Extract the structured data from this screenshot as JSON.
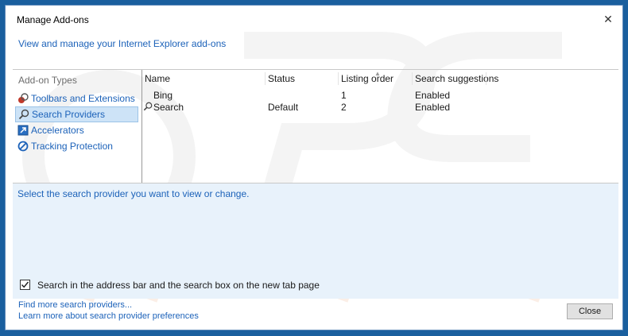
{
  "window": {
    "title": "Manage Add-ons",
    "header_link": "View and manage your Internet Explorer add-ons"
  },
  "sidebar": {
    "heading": "Add-on Types",
    "items": [
      {
        "label": "Toolbars and Extensions",
        "icon": "toolbars-extensions-icon"
      },
      {
        "label": "Search Providers",
        "icon": "search-providers-icon",
        "selected": true
      },
      {
        "label": "Accelerators",
        "icon": "accelerators-icon"
      },
      {
        "label": "Tracking Protection",
        "icon": "tracking-protection-icon"
      }
    ]
  },
  "list": {
    "columns": [
      "Name",
      "Status",
      "Listing order",
      "Search suggestions"
    ],
    "rows": [
      {
        "name": "Bing",
        "status": "",
        "order": "1",
        "suggestions": "Enabled"
      },
      {
        "name": "Search",
        "status": "Default",
        "order": "2",
        "suggestions": "Enabled"
      }
    ]
  },
  "detail": {
    "prompt": "Select the search provider you want to view or change.",
    "checkbox_label": "Search in the address bar and the search box on the new tab page",
    "checkbox_checked": true
  },
  "footer": {
    "link1": "Find more search providers...",
    "link2": "Learn more about search provider preferences",
    "close_label": "Close"
  },
  "colors": {
    "link": "#1c62b9",
    "selected_bg": "#cde3f7",
    "detail_bg": "#e8f2fb"
  }
}
